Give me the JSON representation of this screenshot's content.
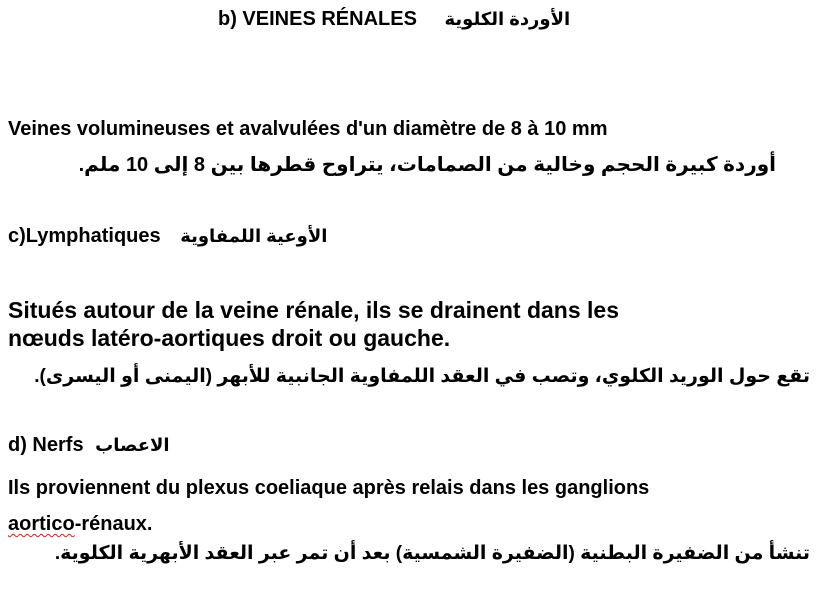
{
  "title": {
    "fr": "b) VEINES RÉNALES",
    "ar": "الأوردة الكلوية"
  },
  "veines": {
    "fr": "Veines volumineuses et avalvulées d'un diamètre de 8 à 10 mm",
    "ar": "أوردة كبيرة الحجم وخالية من الصمامات، يتراوح قطرها بين 8 إلى 10 ملم."
  },
  "lymphatiques": {
    "heading_fr": "c)Lymphatiques",
    "heading_ar": "الأوعية اللمفاوية",
    "fr_line1": "Situés autour de la veine rénale, ils se drainent dans les",
    "fr_line2": "nœuds latéro-aortiques droit ou gauche.",
    "ar": "تقع حول الوريد الكلوي، وتصب في العقد اللمفاوية الجانبية للأبهر (اليمنى أو اليسرى)."
  },
  "nerfs": {
    "heading_fr": "d) Nerfs",
    "heading_ar": "الاعصاب",
    "fr_line1": "Ils proviennent du plexus coeliaque après relais dans les ganglions",
    "fr_line2a": "aortico",
    "fr_line2b": "-rénaux.",
    "ar": "تنشأ من الضفيرة البطنية (الضفيرة الشمسية) بعد أن تمر عبر العقد الأبهرية الكلوية."
  }
}
